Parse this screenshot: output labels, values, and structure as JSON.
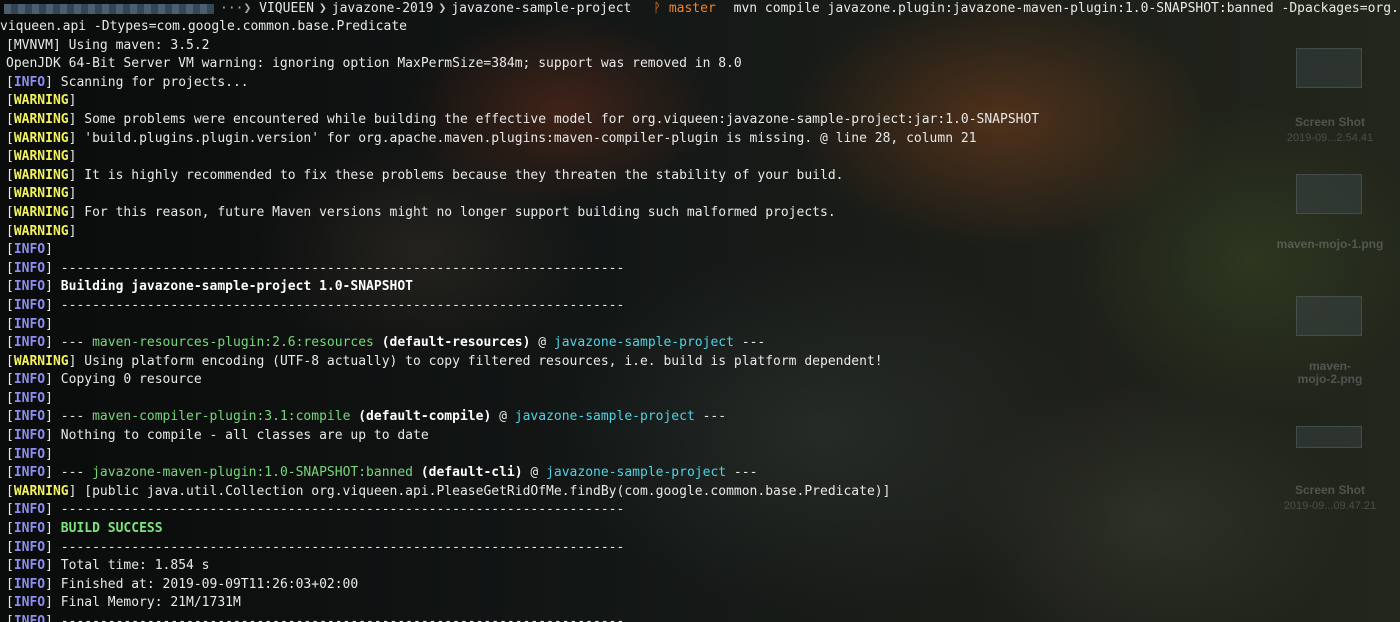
{
  "prompt": {
    "path_segments": [
      "VIQUEEN",
      "javazone-2019",
      "javazone-sample-project"
    ],
    "git_icon": "ᚹ",
    "git_branch": "master",
    "command_line1": "mvn compile javazone.plugin:javazone-maven-plugin:1.0-SNAPSHOT:banned -Dpackages=org.",
    "command_line2": "viqueen.api -Dtypes=com.google.common.base.Predicate",
    "separator_glyph": "❯",
    "path_lead": "···❯",
    "colors": {
      "git": "#f0832c",
      "text": "#e8e8e8"
    }
  },
  "colors": {
    "info": "#8c8ff0",
    "warning": "#f2f25e",
    "plugin": "#76d77a",
    "project": "#4fd3e3",
    "success": "#7ee47e"
  },
  "desktop": {
    "labels": [
      {
        "title": "Screen Shot",
        "sub": "2019-09...2.54.41"
      },
      {
        "title": "maven-mojo-1.png",
        "sub": ""
      },
      {
        "title": "maven-\nmojo-2.png",
        "sub": ""
      },
      {
        "title": "Screen Shot",
        "sub": "2019-09...09.47.21"
      }
    ]
  },
  "output": {
    "lines": [
      {
        "level": "MVNVM",
        "segments": [
          {
            "text": " Using maven: 3.5.2"
          }
        ]
      },
      {
        "level": "",
        "segments": [
          {
            "text": "OpenJDK 64-Bit Server VM warning: ignoring option MaxPermSize=384m; support was removed in 8.0"
          }
        ]
      },
      {
        "level": "INFO",
        "segments": [
          {
            "text": " Scanning for projects..."
          }
        ]
      },
      {
        "level": "WARNING",
        "segments": []
      },
      {
        "level": "WARNING",
        "segments": [
          {
            "text": " Some problems were encountered while building the effective model for org.viqueen:javazone-sample-project:jar:1.0-SNAPSHOT"
          }
        ]
      },
      {
        "level": "WARNING",
        "segments": [
          {
            "text": " 'build.plugins.plugin.version' for org.apache.maven.plugins:maven-compiler-plugin is missing. @ line 28, column 21"
          }
        ]
      },
      {
        "level": "WARNING",
        "segments": []
      },
      {
        "level": "WARNING",
        "segments": [
          {
            "text": " It is highly recommended to fix these problems because they threaten the stability of your build."
          }
        ]
      },
      {
        "level": "WARNING",
        "segments": []
      },
      {
        "level": "WARNING",
        "segments": [
          {
            "text": " For this reason, future Maven versions might no longer support building such malformed projects."
          }
        ]
      },
      {
        "level": "WARNING",
        "segments": []
      },
      {
        "level": "INFO",
        "segments": []
      },
      {
        "level": "INFO",
        "segments": [
          {
            "text": " ------------------------------------------------------------------------"
          }
        ]
      },
      {
        "level": "INFO",
        "segments": [
          {
            "text": " "
          },
          {
            "text": "Building javazone-sample-project 1.0-SNAPSHOT",
            "style": "bold"
          }
        ]
      },
      {
        "level": "INFO",
        "segments": [
          {
            "text": " ------------------------------------------------------------------------"
          }
        ]
      },
      {
        "level": "INFO",
        "segments": []
      },
      {
        "level": "INFO",
        "segments": [
          {
            "text": " --- "
          },
          {
            "text": "maven-resources-plugin:2.6:resources",
            "style": "plugin"
          },
          {
            "text": " "
          },
          {
            "text": "(default-resources)",
            "style": "bold"
          },
          {
            "text": " @ "
          },
          {
            "text": "javazone-sample-project",
            "style": "project"
          },
          {
            "text": " ---"
          }
        ]
      },
      {
        "level": "WARNING",
        "segments": [
          {
            "text": " Using platform encoding (UTF-8 actually) to copy filtered resources, i.e. build is platform dependent!"
          }
        ]
      },
      {
        "level": "INFO",
        "segments": [
          {
            "text": " Copying 0 resource"
          }
        ]
      },
      {
        "level": "INFO",
        "segments": []
      },
      {
        "level": "INFO",
        "segments": [
          {
            "text": " --- "
          },
          {
            "text": "maven-compiler-plugin:3.1:compile",
            "style": "plugin"
          },
          {
            "text": " "
          },
          {
            "text": "(default-compile)",
            "style": "bold"
          },
          {
            "text": " @ "
          },
          {
            "text": "javazone-sample-project",
            "style": "project"
          },
          {
            "text": " ---"
          }
        ]
      },
      {
        "level": "INFO",
        "segments": [
          {
            "text": " Nothing to compile - all classes are up to date"
          }
        ]
      },
      {
        "level": "INFO",
        "segments": []
      },
      {
        "level": "INFO",
        "segments": [
          {
            "text": " --- "
          },
          {
            "text": "javazone-maven-plugin:1.0-SNAPSHOT:banned",
            "style": "plugin"
          },
          {
            "text": " "
          },
          {
            "text": "(default-cli)",
            "style": "bold"
          },
          {
            "text": " @ "
          },
          {
            "text": "javazone-sample-project",
            "style": "project"
          },
          {
            "text": " ---"
          }
        ]
      },
      {
        "level": "WARNING",
        "segments": [
          {
            "text": " [public java.util.Collection org.viqueen.api.PleaseGetRidOfMe.findBy(com.google.common.base.Predicate)]"
          }
        ]
      },
      {
        "level": "INFO",
        "segments": [
          {
            "text": " ------------------------------------------------------------------------"
          }
        ]
      },
      {
        "level": "INFO",
        "segments": [
          {
            "text": " "
          },
          {
            "text": "BUILD SUCCESS",
            "style": "success"
          }
        ]
      },
      {
        "level": "INFO",
        "segments": [
          {
            "text": " ------------------------------------------------------------------------"
          }
        ]
      },
      {
        "level": "INFO",
        "segments": [
          {
            "text": " Total time: 1.854 s"
          }
        ]
      },
      {
        "level": "INFO",
        "segments": [
          {
            "text": " Finished at: 2019-09-09T11:26:03+02:00"
          }
        ]
      },
      {
        "level": "INFO",
        "segments": [
          {
            "text": " Final Memory: 21M/1731M"
          }
        ]
      },
      {
        "level": "INFO",
        "segments": [
          {
            "text": " ------------------------------------------------------------------------"
          }
        ]
      }
    ]
  }
}
